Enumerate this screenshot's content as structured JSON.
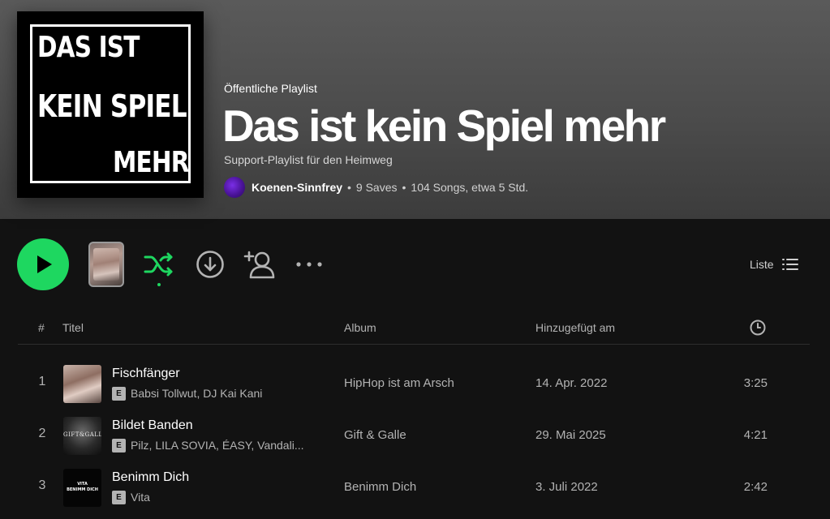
{
  "colors": {
    "accent": "#1ed760",
    "background": "#121212",
    "header_gradient_top": "#5a5a5a",
    "muted_text": "#b3b3b3"
  },
  "cover": {
    "line1": "DAS IST",
    "line2": "KEIN SPIEL",
    "line3": "MEHR"
  },
  "playlist": {
    "type_label": "Öffentliche Playlist",
    "title": "Das ist kein Spiel mehr",
    "description": "Support-Playlist für den Heimweg",
    "owner": "Koenen-Sinnfrey",
    "separator": "•",
    "saves": "9 Saves",
    "songs_duration": "104 Songs, etwa 5 Std."
  },
  "controls": {
    "play_icon": "play-icon",
    "shuffle_icon": "shuffle-icon",
    "download_icon": "download-icon",
    "add_user_icon": "add-user-icon",
    "more_icon": "more-icon",
    "view_label": "Liste",
    "view_icon": "list-view-icon"
  },
  "table": {
    "headers": {
      "number": "#",
      "title": "Titel",
      "album": "Album",
      "added": "Hinzugefügt am",
      "duration_icon": "clock-icon"
    },
    "explicit_badge": "E",
    "rows": [
      {
        "number": "1",
        "title": "Fischfänger",
        "artists": "Babsi Tollwut, DJ Kai Kani",
        "album": "HipHop ist am Arsch",
        "added": "14. Apr. 2022",
        "duration": "3:25"
      },
      {
        "number": "2",
        "title": "Bildet Banden",
        "artists": "Pilz, LILA SOVIA, ÉASY, Vandali...",
        "album": "Gift & Galle",
        "added": "29. Mai 2025",
        "duration": "4:21",
        "art_text": "GIFT&GALLE"
      },
      {
        "number": "3",
        "title": "Benimm Dich",
        "artists": "Vita",
        "album": "Benimm Dich",
        "added": "3. Juli 2022",
        "duration": "2:42",
        "art_text_1": "VITA",
        "art_text_2": "BENIMM DICH"
      }
    ]
  }
}
